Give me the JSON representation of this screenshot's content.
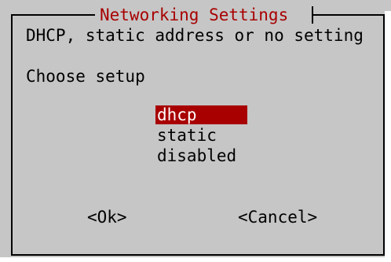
{
  "dialog": {
    "title": "Networking Settings",
    "description": "DHCP, static address or no setting",
    "prompt": "Choose setup"
  },
  "options": [
    {
      "label": "dhcp",
      "selected": true
    },
    {
      "label": "static",
      "selected": false
    },
    {
      "label": "disabled",
      "selected": false
    }
  ],
  "buttons": {
    "ok_label": "<Ok>",
    "cancel_label": "<Cancel>"
  },
  "colors": {
    "background": "#c6c6c6",
    "title": "#a80000",
    "highlight": "#a80000",
    "highlight_text": "#ffffff",
    "text": "#000000"
  }
}
